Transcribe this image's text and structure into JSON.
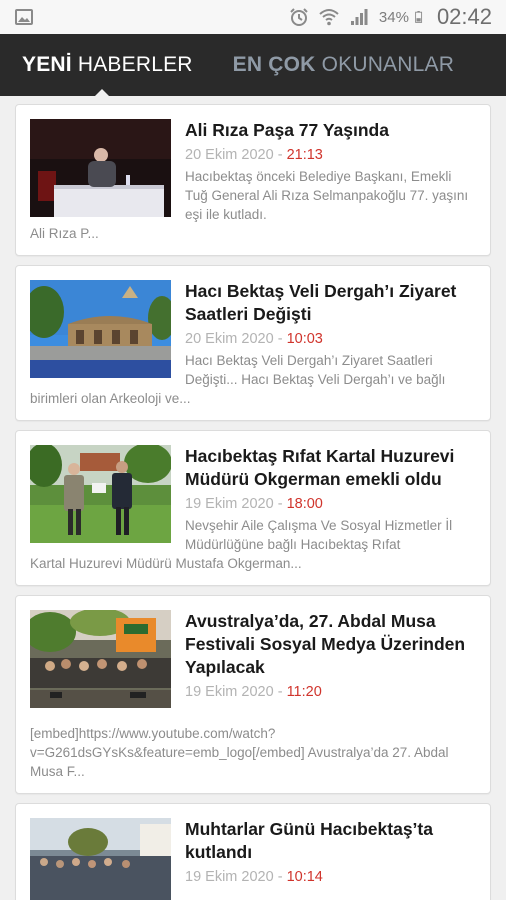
{
  "status": {
    "battery_pct": "34%",
    "time": "02:42"
  },
  "tabs": [
    {
      "bold": "YENİ",
      "rest": " HABERLER"
    },
    {
      "bold": "EN ÇOK",
      "rest": " OKUNANLAR"
    }
  ],
  "articles": [
    {
      "title": "Ali Rıza Paşa 77 Yaşında",
      "date": "20 Ekim 2020 - ",
      "time": "21:13",
      "summary_side": "Hacıbektaş önceki Belediye Başkanı, Emekli Tuğ General Ali Rıza Selmanpakoğlu 77. yaşını eşi ile kutladı.",
      "summary_full": "Ali Rıza P..."
    },
    {
      "title": "Hacı Bektaş Veli Dergah’ı Ziyaret Saatleri Değişti",
      "date": "20 Ekim 2020 - ",
      "time": "10:03",
      "summary_side": "Hacı Bektaş Veli Dergah’ı Ziyaret Saatleri Değişti... Hacı Bektaş Veli Dergah’ı ve bağlı",
      "summary_full": "birimleri olan Arkeoloji ve..."
    },
    {
      "title": "Hacıbektaş Rıfat Kartal Huzurevi Müdürü Okgerman emekli oldu",
      "date": "19 Ekim 2020 - ",
      "time": "18:00",
      "summary_side": "Nevşehir Aile Çalışma Ve Sosyal Hizmetler İl Müdürlüğüne bağlı Hacıbektaş Rıfat",
      "summary_full": "Kartal Huzurevi Müdürü Mustafa Okgerman..."
    },
    {
      "title": "Avustralya’da, 27. Abdal Musa Festivali Sosyal Medya Üzerinden Yapılacak",
      "date": "19 Ekim 2020 - ",
      "time": "11:20",
      "summary_side": "",
      "summary_full": "[embed]https://www.youtube.com/watch?v=G261dsGYsKs&feature=emb_logo[/embed] Avustralya’da 27. Abdal Musa F..."
    },
    {
      "title": "Muhtarlar Günü Hacıbektaş’ta kutlandı",
      "date": "19 Ekim 2020 - ",
      "time": "10:14",
      "summary_side": "",
      "summary_full": ""
    }
  ]
}
